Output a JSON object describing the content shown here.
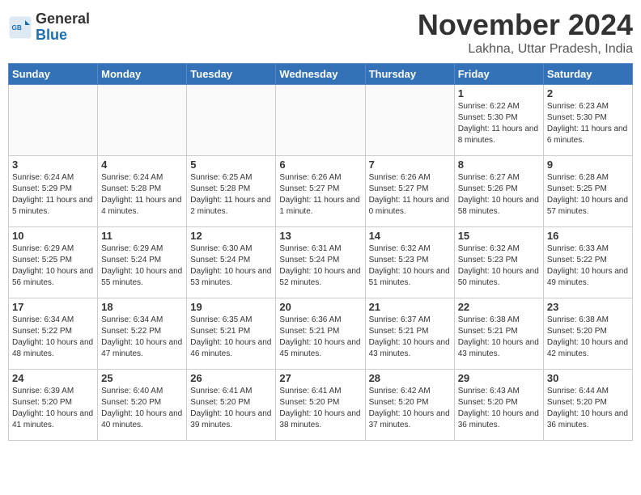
{
  "header": {
    "logo": {
      "general": "General",
      "blue": "Blue"
    },
    "title": "November 2024",
    "location": "Lakhna, Uttar Pradesh, India"
  },
  "weekdays": [
    "Sunday",
    "Monday",
    "Tuesday",
    "Wednesday",
    "Thursday",
    "Friday",
    "Saturday"
  ],
  "weeks": [
    [
      {
        "day": "",
        "info": ""
      },
      {
        "day": "",
        "info": ""
      },
      {
        "day": "",
        "info": ""
      },
      {
        "day": "",
        "info": ""
      },
      {
        "day": "",
        "info": ""
      },
      {
        "day": "1",
        "info": "Sunrise: 6:22 AM\nSunset: 5:30 PM\nDaylight: 11 hours and 8 minutes."
      },
      {
        "day": "2",
        "info": "Sunrise: 6:23 AM\nSunset: 5:30 PM\nDaylight: 11 hours and 6 minutes."
      }
    ],
    [
      {
        "day": "3",
        "info": "Sunrise: 6:24 AM\nSunset: 5:29 PM\nDaylight: 11 hours and 5 minutes."
      },
      {
        "day": "4",
        "info": "Sunrise: 6:24 AM\nSunset: 5:28 PM\nDaylight: 11 hours and 4 minutes."
      },
      {
        "day": "5",
        "info": "Sunrise: 6:25 AM\nSunset: 5:28 PM\nDaylight: 11 hours and 2 minutes."
      },
      {
        "day": "6",
        "info": "Sunrise: 6:26 AM\nSunset: 5:27 PM\nDaylight: 11 hours and 1 minute."
      },
      {
        "day": "7",
        "info": "Sunrise: 6:26 AM\nSunset: 5:27 PM\nDaylight: 11 hours and 0 minutes."
      },
      {
        "day": "8",
        "info": "Sunrise: 6:27 AM\nSunset: 5:26 PM\nDaylight: 10 hours and 58 minutes."
      },
      {
        "day": "9",
        "info": "Sunrise: 6:28 AM\nSunset: 5:25 PM\nDaylight: 10 hours and 57 minutes."
      }
    ],
    [
      {
        "day": "10",
        "info": "Sunrise: 6:29 AM\nSunset: 5:25 PM\nDaylight: 10 hours and 56 minutes."
      },
      {
        "day": "11",
        "info": "Sunrise: 6:29 AM\nSunset: 5:24 PM\nDaylight: 10 hours and 55 minutes."
      },
      {
        "day": "12",
        "info": "Sunrise: 6:30 AM\nSunset: 5:24 PM\nDaylight: 10 hours and 53 minutes."
      },
      {
        "day": "13",
        "info": "Sunrise: 6:31 AM\nSunset: 5:24 PM\nDaylight: 10 hours and 52 minutes."
      },
      {
        "day": "14",
        "info": "Sunrise: 6:32 AM\nSunset: 5:23 PM\nDaylight: 10 hours and 51 minutes."
      },
      {
        "day": "15",
        "info": "Sunrise: 6:32 AM\nSunset: 5:23 PM\nDaylight: 10 hours and 50 minutes."
      },
      {
        "day": "16",
        "info": "Sunrise: 6:33 AM\nSunset: 5:22 PM\nDaylight: 10 hours and 49 minutes."
      }
    ],
    [
      {
        "day": "17",
        "info": "Sunrise: 6:34 AM\nSunset: 5:22 PM\nDaylight: 10 hours and 48 minutes."
      },
      {
        "day": "18",
        "info": "Sunrise: 6:34 AM\nSunset: 5:22 PM\nDaylight: 10 hours and 47 minutes."
      },
      {
        "day": "19",
        "info": "Sunrise: 6:35 AM\nSunset: 5:21 PM\nDaylight: 10 hours and 46 minutes."
      },
      {
        "day": "20",
        "info": "Sunrise: 6:36 AM\nSunset: 5:21 PM\nDaylight: 10 hours and 45 minutes."
      },
      {
        "day": "21",
        "info": "Sunrise: 6:37 AM\nSunset: 5:21 PM\nDaylight: 10 hours and 43 minutes."
      },
      {
        "day": "22",
        "info": "Sunrise: 6:38 AM\nSunset: 5:21 PM\nDaylight: 10 hours and 43 minutes."
      },
      {
        "day": "23",
        "info": "Sunrise: 6:38 AM\nSunset: 5:20 PM\nDaylight: 10 hours and 42 minutes."
      }
    ],
    [
      {
        "day": "24",
        "info": "Sunrise: 6:39 AM\nSunset: 5:20 PM\nDaylight: 10 hours and 41 minutes."
      },
      {
        "day": "25",
        "info": "Sunrise: 6:40 AM\nSunset: 5:20 PM\nDaylight: 10 hours and 40 minutes."
      },
      {
        "day": "26",
        "info": "Sunrise: 6:41 AM\nSunset: 5:20 PM\nDaylight: 10 hours and 39 minutes."
      },
      {
        "day": "27",
        "info": "Sunrise: 6:41 AM\nSunset: 5:20 PM\nDaylight: 10 hours and 38 minutes."
      },
      {
        "day": "28",
        "info": "Sunrise: 6:42 AM\nSunset: 5:20 PM\nDaylight: 10 hours and 37 minutes."
      },
      {
        "day": "29",
        "info": "Sunrise: 6:43 AM\nSunset: 5:20 PM\nDaylight: 10 hours and 36 minutes."
      },
      {
        "day": "30",
        "info": "Sunrise: 6:44 AM\nSunset: 5:20 PM\nDaylight: 10 hours and 36 minutes."
      }
    ]
  ]
}
